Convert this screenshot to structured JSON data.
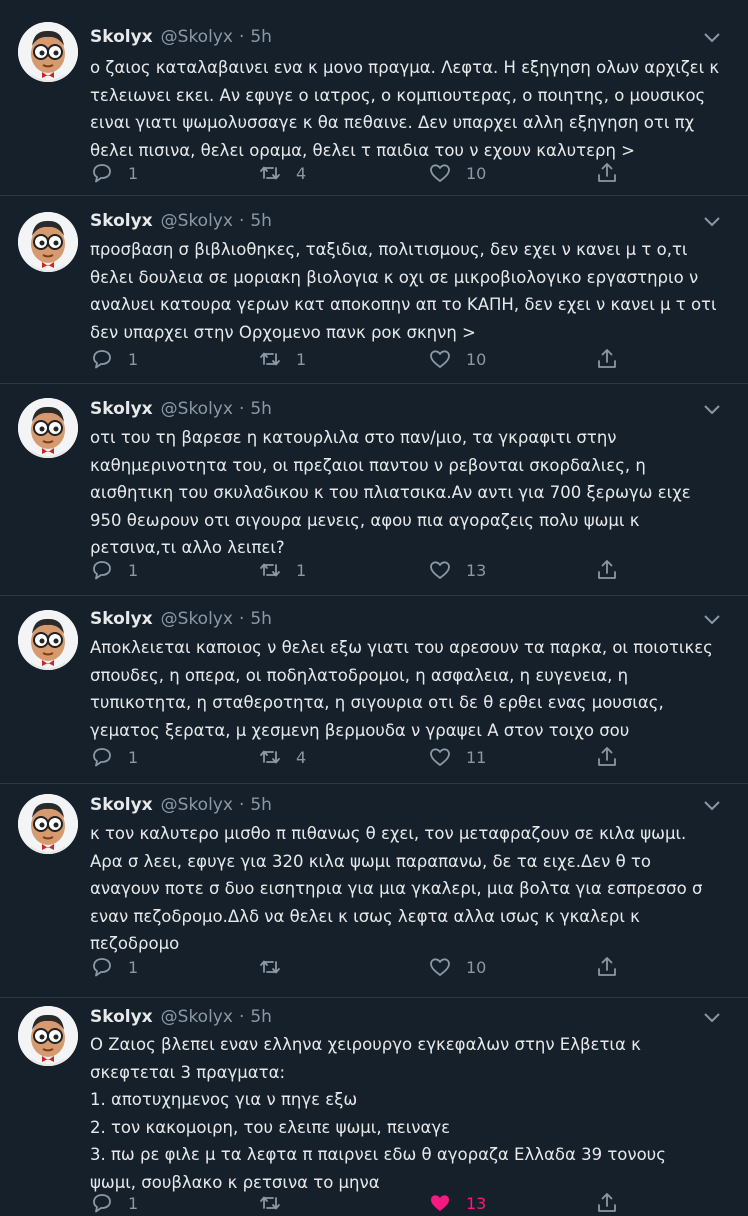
{
  "colors": {
    "background": "#15202b",
    "text": "#e7e9ea",
    "secondary": "#8b98a5",
    "divider": "#2b3945",
    "like_active": "#f91880"
  },
  "icons": {
    "reply": "comment-bubble-icon",
    "retweet": "retweet-icon",
    "like": "heart-icon",
    "share": "share-upload-icon",
    "menu": "chevron-down-icon"
  },
  "tweets": [
    {
      "name": "Skolyx",
      "handle": "@Skolyx",
      "time": "5h",
      "lines": [
        "ο ζαιος καταλαβαινει ενα κ μονο πραγμα. Λεφτα. Η εξηγηση ολων αρχιζει κ",
        "τελειωνει εκει. Αν εφυγε ο ιατρος, ο κομπιουτερας, ο ποιητης, ο μουσικος",
        "ειναι γιατι ψωμολυσσαγε κ θα πεθαινε. Δεν υπαρχει αλλη εξηγηση οτι πχ",
        "θελει πισινα, θελει οραμα, θελει τ παιδια του ν εχουν καλυτερη >"
      ],
      "replies": "1",
      "retweets": "4",
      "likes": "10"
    },
    {
      "name": "Skolyx",
      "handle": "@Skolyx",
      "time": "5h",
      "lines": [
        "προσβαση σ βιβλιοθηκες, ταξιδια, πολιτισμους, δεν εχει ν κανει μ τ ο,τι",
        "θελει δουλεια σε μοριακη βιολογια κ οχι σε μικροβιολογικο εργαστηριο ν",
        "αναλυει κατουρα γερων κατ αποκοπην απ το ΚΑΠΗ, δεν εχει ν κανει μ τ οτι",
        "δεν υπαρχει στην Ορχομενο πανκ ροκ σκηνη >"
      ],
      "replies": "1",
      "retweets": "1",
      "likes": "10"
    },
    {
      "name": "Skolyx",
      "handle": "@Skolyx",
      "time": "5h",
      "lines": [
        "οτι του τη βαρεσε η κατουρλιλα στο παν/μιο, τα γκραφιτι στην",
        "καθημερινοτητα του, οι πρεζαιοι παντου ν ρεβονται σκορδαλιες, η",
        "αισθητικη του σκυλαδικου κ του πλιατσικα.Αν αντι για 700 ξερωγω ειχε",
        "950 θεωρουν οτι σιγουρα μενεις, αφου πια αγοραζεις πολυ ψωμι κ",
        "ρετσινα,τι αλλο λειπει?"
      ],
      "replies": "1",
      "retweets": "1",
      "likes": "13"
    },
    {
      "name": "Skolyx",
      "handle": "@Skolyx",
      "time": "5h",
      "lines": [
        "Αποκλειεται καποιος ν θελει εξω γιατι του αρεσουν τα παρκα, οι ποιοτικες",
        "σπουδες, η οπερα, οι ποδηλατοδρομοι, η ασφαλεια, η ευγενεια, η",
        "τυπικοτητα, η σταθεροτητα, η σιγουρια οτι δε θ ερθει ενας μουσιας,",
        "γεματος ξερατα, μ χεσμενη βερμουδα ν γραψει Α στον τοιχο σου"
      ],
      "replies": "1",
      "retweets": "4",
      "likes": "11"
    },
    {
      "name": "Skolyx",
      "handle": "@Skolyx",
      "time": "5h",
      "lines": [
        "κ τον καλυτερο μισθο π πιθανως θ εχει, τον μεταφραζουν σε κιλα ψωμι.",
        "Αρα σ λεει, εφυγε για 320 κιλα ψωμι παραπανω, δε τα ειχε.Δεν θ το",
        "αναγουν ποτε σ δυο εισητηρια για μια γκαλερι, μια βολτα για εσπρεσσο σ",
        "εναν πεζοδρομο.Δλδ να θελει κ ισως λεφτα αλλα ισως κ γκαλερι κ",
        "πεζοδρομο"
      ],
      "replies": "1",
      "retweets": "",
      "likes": "10"
    },
    {
      "name": "Skolyx",
      "handle": "@Skolyx",
      "time": "5h",
      "lines": [
        "Ο Ζαιος βλεπει εναν ελληνα χειρουργο εγκεφαλων στην Ελβετια κ",
        "σκεφτεται 3 πραγματα:",
        "1. αποτυχημενος για ν πηγε εξω",
        "2. τον κακομοιρη, του ελειπε ψωμι, πειναγε",
        "3. πω ρε φιλε μ τα λεφτα π παιρνει εδω θ αγοραζα Ελλαδα 39 τονους",
        "ψωμι, σουβλακο κ ρετσινα το μηνα"
      ],
      "replies": "1",
      "retweets": "",
      "likes": "13"
    }
  ]
}
